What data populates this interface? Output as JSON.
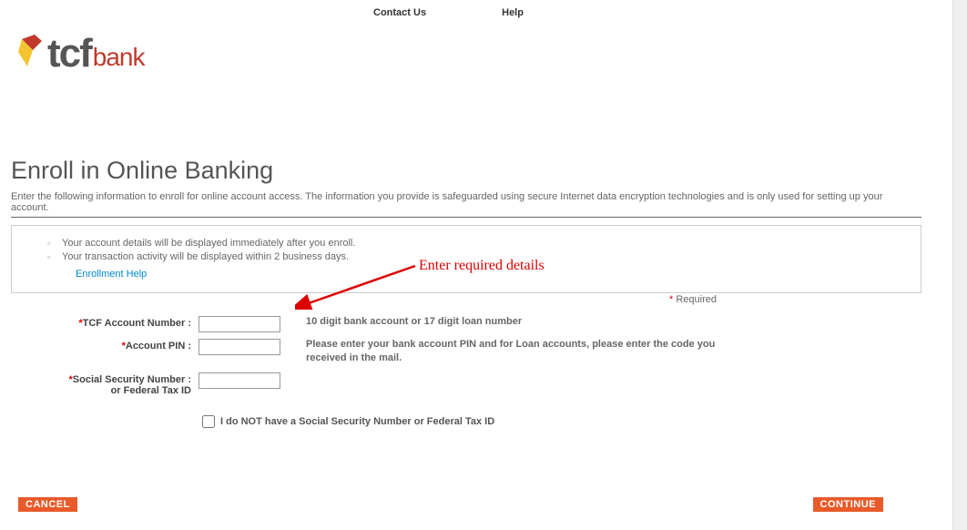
{
  "header": {
    "contact_us": "Contact Us",
    "help": "Help"
  },
  "logo": {
    "tcf": "tcf",
    "bank": "bank"
  },
  "page_title": "Enroll in Online Banking",
  "intro_text": "Enter the following information to enroll for online account access. The information you provide is safeguarded using secure Internet data encryption technologies and is only used for setting up your account.",
  "info_box": {
    "line1": "Your account details will be displayed immediately after you enroll.",
    "line2": "Your transaction activity will be displayed within 2 business days.",
    "enrollment_help": "Enrollment Help"
  },
  "annotation": "Enter required details",
  "required_text": "Required",
  "form": {
    "account_number_label": "TCF Account Number :",
    "account_number_hint": "10 digit bank account or 17 digit loan number",
    "pin_label": "Account PIN :",
    "pin_hint": "Please enter your bank account PIN and for Loan accounts, please enter the code you received in the mail.",
    "ssn_label": "Social Security Number :",
    "ssn_sublabel": "or Federal Tax ID",
    "no_ssn_checkbox": "I do NOT have a Social Security Number or Federal Tax ID"
  },
  "buttons": {
    "cancel": "CANCEL",
    "continue": "CONTINUE"
  }
}
